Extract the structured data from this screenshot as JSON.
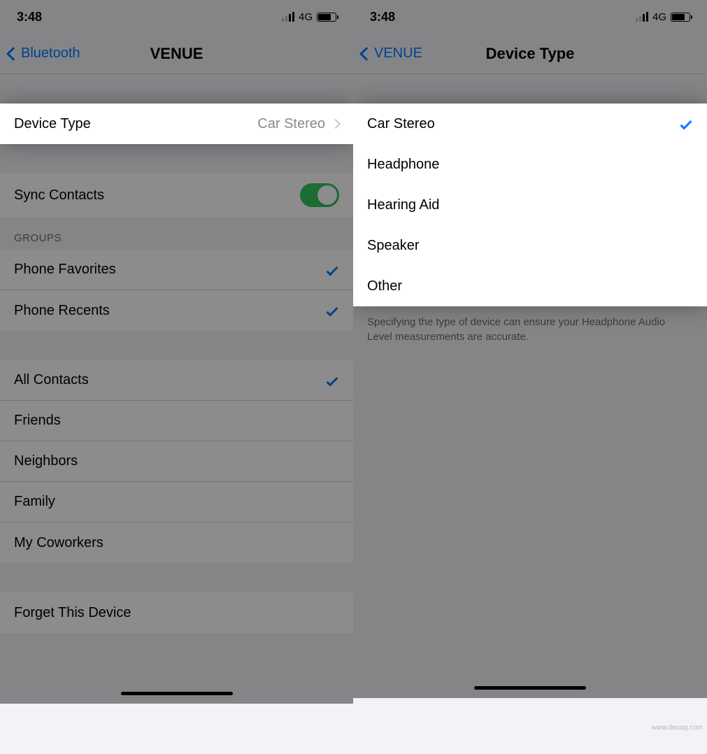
{
  "left": {
    "status": {
      "time": "3:48",
      "network": "4G"
    },
    "nav": {
      "back": "Bluetooth",
      "title": "VENUE"
    },
    "device_type": {
      "label": "Device Type",
      "value": "Car Stereo"
    },
    "sync_contacts_label": "Sync Contacts",
    "groups_header": "Groups",
    "groups": [
      {
        "label": "Phone Favorites",
        "checked": true
      },
      {
        "label": "Phone Recents",
        "checked": true
      }
    ],
    "contacts": [
      {
        "label": "All Contacts",
        "checked": true
      },
      {
        "label": "Friends",
        "checked": false
      },
      {
        "label": "Neighbors",
        "checked": false
      },
      {
        "label": "Family",
        "checked": false
      },
      {
        "label": "My Coworkers",
        "checked": false
      }
    ],
    "forget": "Forget This Device"
  },
  "right": {
    "status": {
      "time": "3:48",
      "network": "4G"
    },
    "nav": {
      "back": "VENUE",
      "title": "Device Type"
    },
    "options": [
      {
        "label": "Car Stereo",
        "checked": true
      },
      {
        "label": "Headphone",
        "checked": false
      },
      {
        "label": "Hearing Aid",
        "checked": false
      },
      {
        "label": "Speaker",
        "checked": false
      },
      {
        "label": "Other",
        "checked": false
      }
    ],
    "footer": "Specifying the type of device can ensure your Headphone Audio Level measurements are accurate."
  },
  "watermark": "www.deuaq.com"
}
